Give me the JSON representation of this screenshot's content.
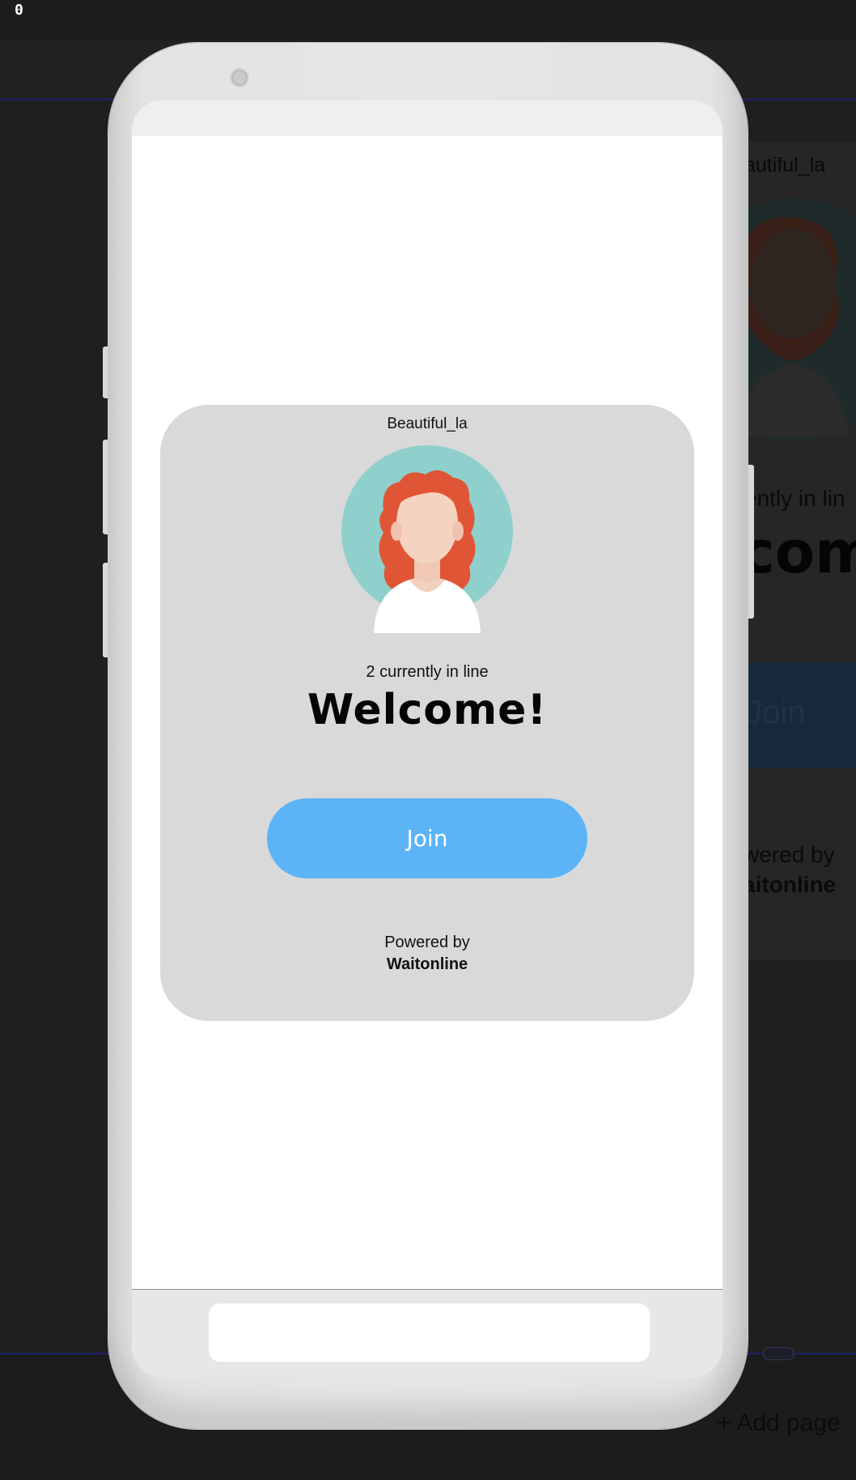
{
  "editor": {
    "top_glyph": "0",
    "add_page_label": "+ Add page"
  },
  "background_preview": {
    "name": "autiful_la",
    "inline_text": "ently in lin",
    "welcome": "com",
    "join": "Join",
    "powered_by": "wered by",
    "brand": "aitonline"
  },
  "card": {
    "business_name": "Beautiful_la",
    "queue_status": "2 currently in line",
    "welcome": "Welcome!",
    "join_label": "Join",
    "powered_by": "Powered by",
    "brand": "Waitonline"
  },
  "colors": {
    "join_button": "#5cb4f7",
    "card_background": "#d9d9d9",
    "avatar_circle": "#8fd0cc",
    "avatar_hair": "#e05535",
    "avatar_skin": "#f5d3c1"
  },
  "icons": {
    "avatar": "woman-avatar-icon",
    "camera": "camera-icon"
  }
}
